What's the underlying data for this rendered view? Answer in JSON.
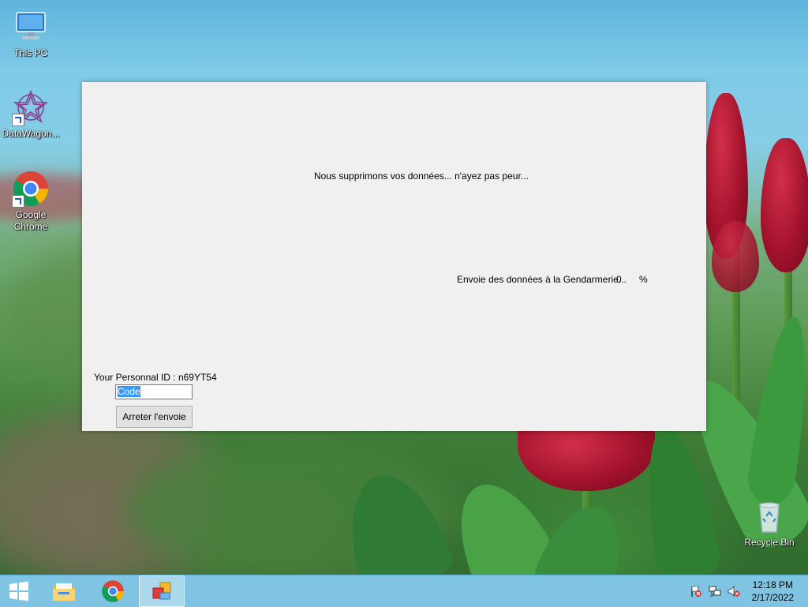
{
  "desktop": {
    "icons": [
      {
        "label": "This PC",
        "icon": "this-pc-icon"
      },
      {
        "label": "DataWagon...",
        "icon": "datawagon-icon"
      },
      {
        "label": "Google Chrome",
        "icon": "chrome-icon"
      },
      {
        "label": "Recycle Bin",
        "icon": "recycle-bin-icon"
      }
    ]
  },
  "app_window": {
    "message": "Nous supprimons vos données... n'ayez pas peur...",
    "send_label": "Envoie des données à la Gendarmerie...",
    "send_percent": "0",
    "percent_sign": "%",
    "personal_id": "Your Personnal ID : n69YT54",
    "code_input": {
      "value": "Code"
    },
    "stop_button_label": "Arreter l'envoie"
  },
  "taskbar": {
    "items": [
      {
        "name": "start-button",
        "icon": "windows-logo-icon"
      },
      {
        "name": "file-explorer",
        "icon": "folder-icon"
      },
      {
        "name": "google-chrome",
        "icon": "chrome-icon"
      },
      {
        "name": "running-app",
        "icon": "app-window-icon",
        "active": true
      }
    ],
    "tray": {
      "icons": [
        "action-center-flag-icon",
        "network-icon",
        "volume-muted-icon"
      ],
      "time": "12:18 PM",
      "date": "2/17/2022"
    }
  },
  "colors": {
    "taskbar_bg": "#7fc4e2",
    "window_bg": "#f0f0f0",
    "selection": "#3399ff"
  }
}
